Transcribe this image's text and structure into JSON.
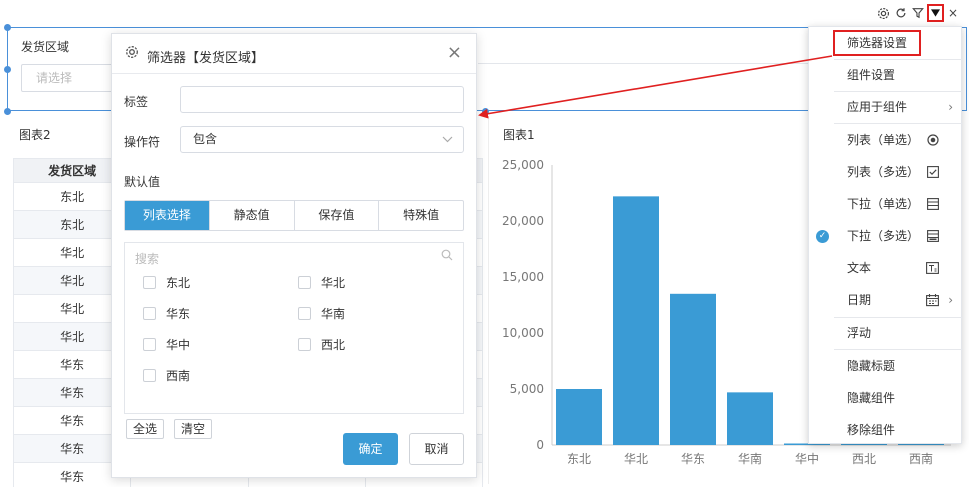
{
  "toolbar": {
    "close": "×"
  },
  "filter_widget": {
    "title": "发货区域",
    "placeholder": "请选择"
  },
  "chart2": {
    "title": "图表2",
    "header": "发货区域",
    "rows": [
      "东北",
      "东北",
      "华北",
      "华北",
      "华北",
      "华北",
      "华东",
      "华东",
      "华东",
      "华东",
      "华东"
    ]
  },
  "chart1": {
    "title": "图表1"
  },
  "chart_data": {
    "type": "bar",
    "categories": [
      "东北",
      "华北",
      "华东",
      "华南",
      "华中",
      "西北",
      "西南"
    ],
    "values": [
      5000,
      22200,
      13500,
      4700,
      100,
      100,
      100
    ],
    "ylim": [
      0,
      25000
    ],
    "yticks": [
      "0",
      "5,000",
      "10,000",
      "15,000",
      "20,000",
      "25,000"
    ],
    "bar_color": "#3a9bd5"
  },
  "modal": {
    "title": "筛选器【发货区域】",
    "close": "×",
    "label_tag": "标签",
    "tag_value": "",
    "label_operator": "操作符",
    "operator_value": "包含",
    "label_default": "默认值",
    "tabs": [
      "列表选择",
      "静态值",
      "保存值",
      "特殊值"
    ],
    "search_placeholder": "搜索",
    "options_left": [
      "东北",
      "华东",
      "华中",
      "西南"
    ],
    "options_right": [
      "华北",
      "华南",
      "西北"
    ],
    "select_all": "全选",
    "clear": "清空",
    "ok": "确定",
    "cancel": "取消"
  },
  "menu": {
    "items": [
      "筛选器设置",
      "组件设置",
      "应用于组件",
      "列表（单选）",
      "列表（多选）",
      "下拉（单选）",
      "下拉（多选）",
      "文本",
      "日期",
      "浮动",
      "隐藏标题",
      "隐藏组件",
      "移除组件"
    ]
  },
  "colors": {
    "accent": "#3a9bd5",
    "highlight": "#e02020"
  }
}
